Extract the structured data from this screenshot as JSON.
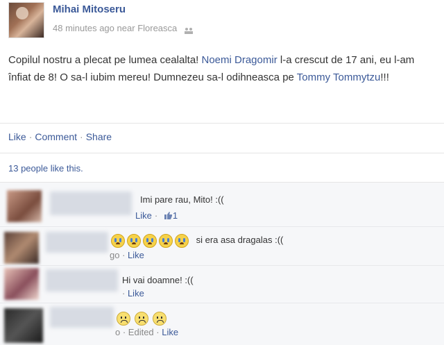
{
  "post": {
    "author": "Mihai Mitoseru",
    "time": "48 minutes ago",
    "location_prefix": "near",
    "location": "Floreasca",
    "privacy_icon": "people-icon",
    "text_part1": "Copilul nostru a plecat pe lumea cealalta! ",
    "mention1": "Noemi Dragomir",
    "text_part2": " l-a crescut de 17 ani, eu l-am înfiat de 8! O sa-l iubim mereu! Dumnezeu sa-l odihneasca pe ",
    "mention2": "Tommy Tommytzu",
    "text_part3": "!!!"
  },
  "actions": {
    "like": "Like",
    "comment": "Comment",
    "share": "Share",
    "separator": "·"
  },
  "likes_summary": "13 people like this.",
  "comments": [
    {
      "text": "Imi pare rau, Mito! :((",
      "meta_like": "Like",
      "meta_prefix": "",
      "like_count": "1",
      "thumb_icon": "thumbs-up-icon"
    },
    {
      "emoji": [
        "crying-face-icon",
        "crying-face-icon",
        "crying-face-icon",
        "crying-face-icon",
        "crying-face-icon"
      ],
      "text": "si era asa dragalas :((",
      "meta_prefix": "go · ",
      "meta_like": "Like"
    },
    {
      "text": "Hi vai doamne! :((",
      "meta_prefix": "· ",
      "meta_like": "Like"
    },
    {
      "emoji": [
        "sad-face-icon",
        "sad-face-icon",
        "sad-face-icon"
      ],
      "meta_prefix": "o · ",
      "edited": "Edited",
      "meta_like": "Like"
    }
  ],
  "colors": {
    "link": "#3b5998",
    "muted": "#999999",
    "comment_bg": "#f6f7f9"
  }
}
